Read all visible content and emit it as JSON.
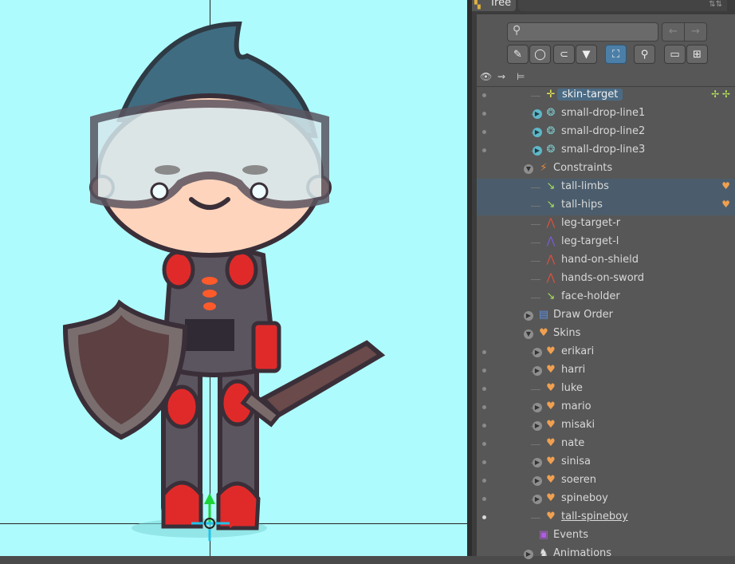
{
  "panel": {
    "tab_title": "Tree",
    "search": {
      "placeholder": ""
    },
    "nav": {
      "back": "←",
      "forward": "→"
    },
    "filter_buttons": [
      {
        "icon": "brush-icon",
        "glyph": "✎",
        "active": false
      },
      {
        "icon": "circle-icon",
        "glyph": "◯",
        "active": false
      },
      {
        "icon": "paperclip-icon",
        "glyph": "⊂",
        "active": false
      },
      {
        "icon": "funnel-icon",
        "glyph": "▼",
        "active": false
      },
      {
        "icon": "frame-select-icon",
        "glyph": "⛶",
        "active": true
      },
      {
        "icon": "pin-icon",
        "glyph": "⚲",
        "active": false
      },
      {
        "icon": "collapse-icon",
        "glyph": "▭",
        "active": false
      },
      {
        "icon": "expand-icon",
        "glyph": "⊞",
        "active": false
      }
    ],
    "columns": {
      "visibility": "👁",
      "keys": "⇝",
      "tree": "⊨"
    }
  },
  "tree": {
    "rows": [
      {
        "label": "skin-target",
        "icon": "target-bone-icon",
        "glyph": "✛",
        "color": "#e6e657",
        "dot": true,
        "highlight": true,
        "expander": "none",
        "tags": "✢ ✢",
        "tag_color": "#b7e659"
      },
      {
        "label": "small-drop-line1",
        "icon": "chain-icon",
        "glyph": "❂",
        "color": "#7bc6c9",
        "dot": true,
        "expander": "teal"
      },
      {
        "label": "small-drop-line2",
        "icon": "chain-icon",
        "glyph": "❂",
        "color": "#7bc6c9",
        "dot": true,
        "expander": "teal"
      },
      {
        "label": "small-drop-line3",
        "icon": "chain-icon",
        "glyph": "❂",
        "color": "#7bc6c9",
        "dot": true,
        "expander": "teal"
      },
      {
        "label": "Constraints",
        "icon": "constraints-icon",
        "glyph": "⚡",
        "color": "#e58a3c",
        "expander": "open",
        "level": 1
      },
      {
        "label": "tall-limbs",
        "icon": "transform-constraint-icon",
        "glyph": "↘",
        "color": "#a6e05c",
        "selected": true,
        "tags": "♥",
        "tag_color": "#f0a050"
      },
      {
        "label": "tall-hips",
        "icon": "transform-constraint-icon",
        "glyph": "↘",
        "color": "#a6e05c",
        "selected": true,
        "tags": "♥",
        "tag_color": "#f0a050"
      },
      {
        "label": "leg-target-r",
        "icon": "ik-constraint-icon",
        "glyph": "⋀",
        "color": "#e0503c"
      },
      {
        "label": "leg-target-l",
        "icon": "ik-constraint-icon",
        "glyph": "⋀",
        "color": "#7a5ce0"
      },
      {
        "label": "hand-on-shield",
        "icon": "ik-constraint-icon",
        "glyph": "⋀",
        "color": "#e0503c"
      },
      {
        "label": "hands-on-sword",
        "icon": "ik-constraint-icon",
        "glyph": "⋀",
        "color": "#e0503c"
      },
      {
        "label": "face-holder",
        "icon": "transform-constraint-icon",
        "glyph": "↘",
        "color": "#a6e05c"
      },
      {
        "label": "Draw Order",
        "icon": "draw-order-icon",
        "glyph": "▤",
        "color": "#5c8ee0",
        "expander": "closed",
        "level": 1
      },
      {
        "label": "Skins",
        "icon": "skins-icon",
        "glyph": "♥",
        "color": "#f0a050",
        "expander": "open",
        "level": 1
      },
      {
        "label": "erikari",
        "icon": "skin-icon",
        "glyph": "♥",
        "color": "#f0a050",
        "dot": true,
        "expander": "closed"
      },
      {
        "label": "harri",
        "icon": "skin-icon",
        "glyph": "♥",
        "color": "#f0a050",
        "dot": true,
        "expander": "closed"
      },
      {
        "label": "luke",
        "icon": "skin-icon",
        "glyph": "♥",
        "color": "#f0a050",
        "dot": true,
        "expander": "none"
      },
      {
        "label": "mario",
        "icon": "skin-icon",
        "glyph": "♥",
        "color": "#f0a050",
        "dot": true,
        "expander": "closed"
      },
      {
        "label": "misaki",
        "icon": "skin-icon",
        "glyph": "♥",
        "color": "#f0a050",
        "dot": true,
        "expander": "closed"
      },
      {
        "label": "nate",
        "icon": "skin-icon",
        "glyph": "♥",
        "color": "#f0a050",
        "dot": true,
        "expander": "none"
      },
      {
        "label": "sinisa",
        "icon": "skin-icon",
        "glyph": "♥",
        "color": "#f0a050",
        "dot": true,
        "expander": "closed"
      },
      {
        "label": "soeren",
        "icon": "skin-icon",
        "glyph": "♥",
        "color": "#f0a050",
        "dot": true,
        "expander": "closed"
      },
      {
        "label": "spineboy",
        "icon": "skin-icon",
        "glyph": "♥",
        "color": "#f0a050",
        "dot": true,
        "expander": "closed"
      },
      {
        "label": "tall-spineboy",
        "icon": "skin-icon",
        "glyph": "♥",
        "color": "#f0a050",
        "dot": true,
        "dot_bright": true,
        "expander": "none",
        "underline": true
      },
      {
        "label": "Events",
        "icon": "events-icon",
        "glyph": "▣",
        "color": "#b05ce0",
        "expander": "none",
        "level": 1
      },
      {
        "label": "Animations",
        "icon": "animations-icon",
        "glyph": "♞",
        "color": "#e0e0e0",
        "expander": "closed",
        "level": 1
      }
    ]
  },
  "colors": {
    "viewport_bg": "#aefbfd",
    "panel_bg": "#575757",
    "selection": "#4b5d6c",
    "accent": "#4b7fa8"
  }
}
